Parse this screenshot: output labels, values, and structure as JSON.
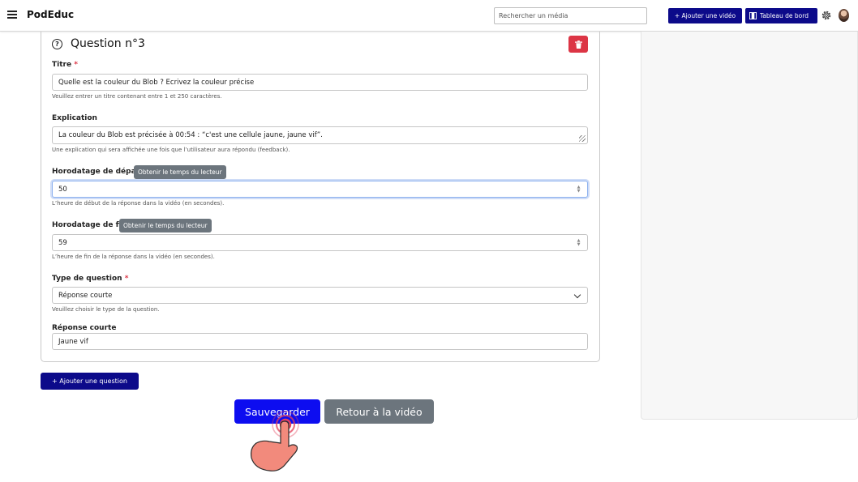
{
  "navbar": {
    "brand": "PodEduc",
    "search_placeholder": "Rechercher un média",
    "add_video_label": "+ Ajouter une vidéo",
    "dashboard_label": "Tableau de bord"
  },
  "question": {
    "title": "Question n°3",
    "titre_label": "Titre",
    "required_mark": "*",
    "titre_value": "Quelle est la couleur du Blob ? Ecrivez la couleur précise",
    "titre_help": "Veuillez entrer un titre contenant entre 1 et 250 caractères.",
    "explication_label": "Explication",
    "explication_value": "La couleur du Blob est précisée à 00:54 : “c'est une cellule jaune, jaune vif”.",
    "explication_help": "Une explication qui sera affichée une fois que l’utilisateur aura répondu (feedback).",
    "start_label": "Horodatage de départ",
    "start_tooltip": "Obtenir le temps du lecteur",
    "start_value": "50",
    "start_help": "L’heure de début de la réponse dans la vidéo (en secondes).",
    "end_label": "Horodatage de fin",
    "end_tooltip": "Obtenir le temps du lecteur",
    "end_value": "59",
    "end_help": "L’heure de fin de la réponse dans la vidéo (en secondes).",
    "type_label": "Type de question",
    "type_value": "Réponse courte",
    "type_help": "Veuillez choisir le type de la question.",
    "short_answer_label": "Réponse courte",
    "short_answer_value": "Jaune vif"
  },
  "actions": {
    "add_question": "+ Ajouter une question",
    "save": "Sauvegarder",
    "back": "Retour à la vidéo"
  },
  "colors": {
    "primary_navy": "#0c0a8a",
    "save_blue": "#0d0df0",
    "secondary_grey": "#6c757d",
    "danger_red": "#dc3545"
  }
}
